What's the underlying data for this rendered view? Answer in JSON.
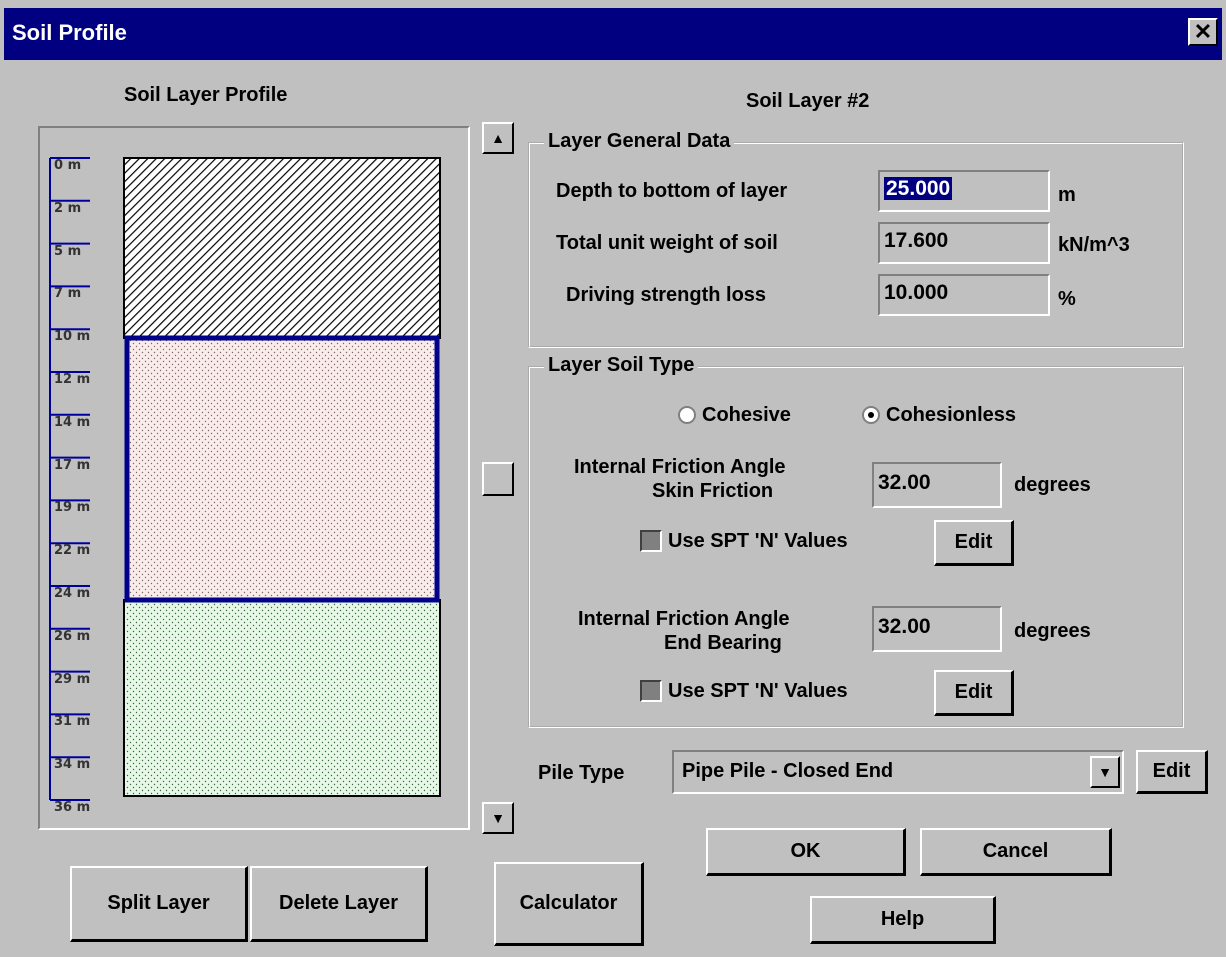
{
  "window": {
    "title": "Soil Profile",
    "close_icon": "close-icon"
  },
  "profile": {
    "heading": "Soil Layer Profile",
    "scale": [
      "0 m",
      "2 m",
      "5 m",
      "7 m",
      "10 m",
      "12 m",
      "14 m",
      "17 m",
      "19 m",
      "22 m",
      "24 m",
      "26 m",
      "29 m",
      "31 m",
      "34 m",
      "36 m"
    ]
  },
  "layer_heading": "Soil Layer #2",
  "general": {
    "legend": "Layer General Data",
    "depth_label": "Depth to bottom of layer",
    "depth_value": "25.000",
    "depth_unit": "m",
    "weight_label": "Total unit weight of soil",
    "weight_value": "17.600",
    "weight_unit": "kN/m^3",
    "loss_label": "Driving strength loss",
    "loss_value": "10.000",
    "loss_unit": "%"
  },
  "soil_type": {
    "legend": "Layer Soil Type",
    "cohesive_label": "Cohesive",
    "cohesionless_label": "Cohesionless",
    "selected": "Cohesionless",
    "skin_label_1": "Internal Friction Angle",
    "skin_label_2": "Skin Friction",
    "skin_value": "32.00",
    "skin_unit": "degrees",
    "spt1_label": "Use SPT 'N' Values",
    "edit1": "Edit",
    "end_label_1": "Internal Friction Angle",
    "end_label_2": "End Bearing",
    "end_value": "32.00",
    "end_unit": "degrees",
    "spt2_label": "Use SPT 'N' Values",
    "edit2": "Edit"
  },
  "pile": {
    "label": "Pile Type",
    "value": "Pipe Pile - Closed End",
    "edit": "Edit"
  },
  "buttons": {
    "ok": "OK",
    "cancel": "Cancel",
    "help": "Help",
    "split": "Split Layer",
    "delete": "Delete Layer",
    "calculator": "Calculator"
  }
}
